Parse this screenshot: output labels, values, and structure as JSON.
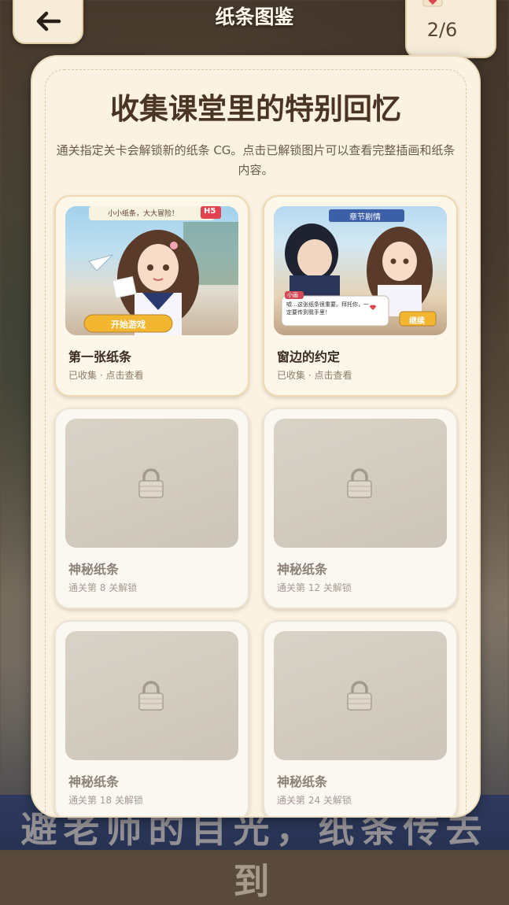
{
  "header": {
    "title": "纸条图鉴",
    "counter": "2/6",
    "back_icon": "arrow-left-icon",
    "heart_icon": "heart-icon"
  },
  "panel": {
    "heading": "收集课堂里的特别回忆",
    "description": "通关指定关卡会解锁新的纸条 CG。点击已解锁图片可以查看完整插画和纸条内容。"
  },
  "cards": [
    {
      "title": "第一张纸条",
      "status": "已收集 · 点击查看",
      "unlocked": true,
      "art": {
        "banner": "小小纸条，大大冒险！",
        "badge": "H5",
        "button": "开始游戏"
      }
    },
    {
      "title": "窗边的约定",
      "status": "已收集 · 点击查看",
      "unlocked": true,
      "art": {
        "banner": "章节剧情",
        "speaker": "小画",
        "dialog": "嘘…这张纸条很重要。拜托你，一定要传到我手里！",
        "button": "继续"
      }
    },
    {
      "title": "神秘纸条",
      "status": "通关第 8 关解锁",
      "unlocked": false,
      "icon": "lock-icon"
    },
    {
      "title": "神秘纸条",
      "status": "通关第 12 关解锁",
      "unlocked": false,
      "icon": "lock-icon"
    },
    {
      "title": "神秘纸条",
      "status": "通关第 18 关解锁",
      "unlocked": false,
      "icon": "lock-icon"
    },
    {
      "title": "神秘纸条",
      "status": "通关第 24 关解锁",
      "unlocked": false,
      "icon": "lock-icon"
    }
  ],
  "background": {
    "banner_text": "避老师的目光，纸条传去到"
  },
  "colors": {
    "panel": "#fbf2e2",
    "title_text": "#4a3424",
    "accent_gold": "#f2b630"
  }
}
